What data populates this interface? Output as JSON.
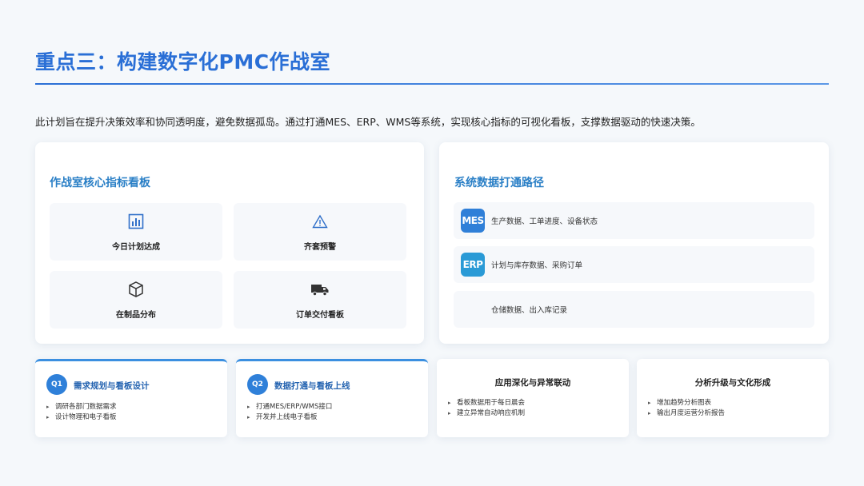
{
  "header": {
    "title": "重点三：构建数字化PMC作战室",
    "intro": "此计划旨在提升决策效率和协同透明度，避免数据孤岛。通过打通MES、ERP、WMS等系统，实现核心指标的可视化看板，支撑数据驱动的快速决策。"
  },
  "kpi_board": {
    "title": "作战室核心指标看板",
    "tiles": [
      {
        "label": "今日计划达成",
        "icon": "bar-chart-icon"
      },
      {
        "label": "齐套预警",
        "icon": "warning-icon"
      },
      {
        "label": "在制品分布",
        "icon": "box-icon"
      },
      {
        "label": "订单交付看板",
        "icon": "truck-icon"
      }
    ]
  },
  "data_path": {
    "title": "系统数据打通路径",
    "rows": [
      {
        "badge": "MES",
        "text": "生产数据、工单进度、设备状态",
        "color": "#2f7fd8"
      },
      {
        "badge": "ERP",
        "text": "计划与库存数据、采购订单",
        "color": "#2a9ad6"
      },
      {
        "badge": "",
        "text": "仓储数据、出入库记录",
        "color": ""
      }
    ]
  },
  "phases": [
    {
      "num": "Q1",
      "title": "需求规划与看板设计",
      "items": [
        "调研各部门数据需求",
        "设计物理和电子看板"
      ]
    },
    {
      "num": "Q2",
      "title": "数据打通与看板上线",
      "items": [
        "打通MES/ERP/WMS接口",
        "开发并上线电子看板"
      ]
    },
    {
      "num": "",
      "title": "应用深化与异常联动",
      "items": [
        "看板数据用于每日晨会",
        "建立异常自动响应机制"
      ]
    },
    {
      "num": "",
      "title": "分析升级与文化形成",
      "items": [
        "增加趋势分析图表",
        "输出月度运营分析报告"
      ]
    }
  ],
  "colors": {
    "accent": "#2a6fd6",
    "card_title": "#2a7fc6",
    "badge_blue": "#2f80d9"
  }
}
